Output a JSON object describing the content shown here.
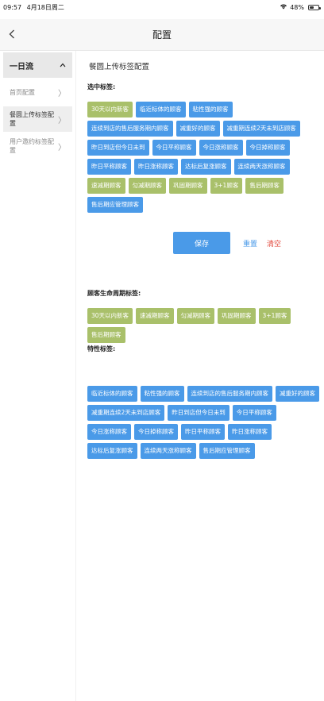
{
  "status_bar": {
    "time": "09:57",
    "date": "4月18日周二",
    "battery": "48%",
    "battery_level": 0.48
  },
  "nav": {
    "title": "配置"
  },
  "sidebar": {
    "group": {
      "label": "一日流",
      "icon": "chevron-up-icon"
    },
    "items": [
      {
        "label": "首页配置"
      },
      {
        "label": "餐圆上传标签配置"
      },
      {
        "label": "用户邀约标签配置"
      }
    ]
  },
  "main": {
    "heading": "餐圆上传标签配置",
    "selected": {
      "title": "选中标签:",
      "tags": [
        {
          "label": "30天以内新客",
          "color": "green"
        },
        {
          "label": "临近标体的顾客",
          "color": "blue"
        },
        {
          "label": "粘性强的顾客",
          "color": "blue"
        },
        {
          "label": "连续到店的售后服务期内顾客",
          "color": "blue"
        },
        {
          "label": "减重好的顾客",
          "color": "blue"
        },
        {
          "label": "减重期连续2天未到店顾客",
          "color": "blue"
        },
        {
          "label": "昨日到店但今日未到",
          "color": "blue"
        },
        {
          "label": "今日平称顾客",
          "color": "blue"
        },
        {
          "label": "今日涨称顾客",
          "color": "blue"
        },
        {
          "label": "今日掉称顾客",
          "color": "blue"
        },
        {
          "label": "昨日平称顾客",
          "color": "blue"
        },
        {
          "label": "昨日涨称顾客",
          "color": "blue"
        },
        {
          "label": "达标后复涨顾客",
          "color": "blue"
        },
        {
          "label": "连续两天涨称顾客",
          "color": "blue"
        },
        {
          "label": "速减期顾客",
          "color": "green"
        },
        {
          "label": "匀减期顾客",
          "color": "green"
        },
        {
          "label": "巩固期顾客",
          "color": "green"
        },
        {
          "label": "3+1顾客",
          "color": "green"
        },
        {
          "label": "售后期顾客",
          "color": "green"
        },
        {
          "label": "售后期应管理顾客",
          "color": "blue"
        }
      ]
    },
    "actions": {
      "save": "保存",
      "reset": "重置",
      "clear": "清空"
    },
    "lifecycle": {
      "title": "顾客生命周期标签:",
      "tags": [
        {
          "label": "30天以内新客",
          "color": "green"
        },
        {
          "label": "速减期顾客",
          "color": "green"
        },
        {
          "label": "匀减期顾客",
          "color": "green"
        },
        {
          "label": "巩固期顾客",
          "color": "green"
        },
        {
          "label": "3+1顾客",
          "color": "green"
        },
        {
          "label": "售后期顾客",
          "color": "green"
        }
      ]
    },
    "traits": {
      "title": "特性标签:",
      "tags": [
        {
          "label": "临近标体的顾客",
          "color": "blue"
        },
        {
          "label": "粘性强的顾客",
          "color": "blue"
        },
        {
          "label": "连续到店的售后服务期内顾客",
          "color": "blue"
        },
        {
          "label": "减重好的顾客",
          "color": "blue"
        },
        {
          "label": "减重期连续2天未到店顾客",
          "color": "blue"
        },
        {
          "label": "昨日到店但今日未到",
          "color": "blue"
        },
        {
          "label": "今日平称顾客",
          "color": "blue"
        },
        {
          "label": "今日涨称顾客",
          "color": "blue"
        },
        {
          "label": "今日掉称顾客",
          "color": "blue"
        },
        {
          "label": "昨日平称顾客",
          "color": "blue"
        },
        {
          "label": "昨日涨称顾客",
          "color": "blue"
        },
        {
          "label": "达标后复涨顾客",
          "color": "blue"
        },
        {
          "label": "连续两天涨称顾客",
          "color": "blue"
        },
        {
          "label": "售后期应管理顾客",
          "color": "blue"
        }
      ]
    }
  },
  "colors": {
    "accent": "#4a9ae8",
    "green_tag": "#a9c06a",
    "danger": "#e2463a"
  }
}
